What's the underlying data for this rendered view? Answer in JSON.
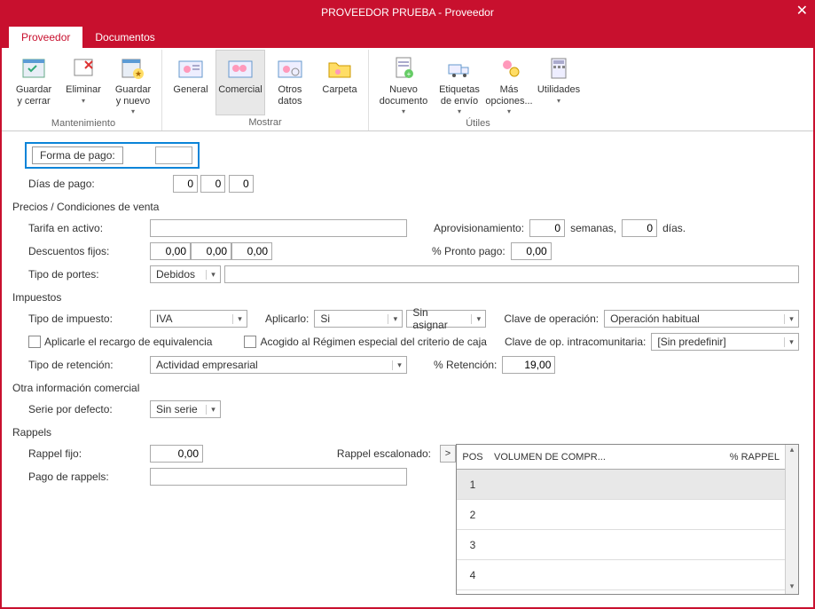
{
  "window": {
    "title": "PROVEEDOR PRUEBA - Proveedor",
    "close_tooltip": "Cerrar"
  },
  "tabs": {
    "active": "Proveedor",
    "items": [
      "Proveedor",
      "Documentos"
    ]
  },
  "ribbon": {
    "groups": [
      {
        "label": "Mantenimiento",
        "items": [
          {
            "label": "Guardar\ny cerrar",
            "icon": "save-close",
            "drop": false
          },
          {
            "label": "Eliminar",
            "icon": "delete",
            "drop": true
          },
          {
            "label": "Guardar\ny nuevo",
            "icon": "save-new",
            "drop": true
          }
        ]
      },
      {
        "label": "Mostrar",
        "items": [
          {
            "label": "General",
            "icon": "user-card",
            "drop": false
          },
          {
            "label": "Comercial",
            "icon": "users-card",
            "drop": false,
            "active": true
          },
          {
            "label": "Otros\ndatos",
            "icon": "user-gear",
            "drop": false
          },
          {
            "label": "Carpeta",
            "icon": "folder-user",
            "drop": false
          }
        ]
      },
      {
        "label": "Útiles",
        "items": [
          {
            "label": "Nuevo\ndocumento",
            "icon": "new-doc",
            "drop": true,
            "wide": true
          },
          {
            "label": "Etiquetas\nde envío",
            "icon": "truck",
            "drop": true
          },
          {
            "label": "Más\nopciones...",
            "icon": "more",
            "drop": true
          },
          {
            "label": "Utilidades",
            "icon": "calc",
            "drop": true
          }
        ]
      }
    ]
  },
  "form": {
    "forma_pago_label": "Forma de pago:",
    "forma_pago_value": "",
    "dias_pago_label": "Días de pago:",
    "dias_pago_values": [
      "0",
      "0",
      "0"
    ],
    "precios_title": "Precios / Condiciones de venta",
    "tarifa_label": "Tarifa en activo:",
    "tarifa_value": "",
    "aprov_label": "Aprovisionamiento:",
    "aprov_semanas": "0",
    "aprov_semanas_unit": "semanas,",
    "aprov_dias": "0",
    "aprov_dias_unit": "días.",
    "desc_label": "Descuentos fijos:",
    "desc_values": [
      "0,00",
      "0,00",
      "0,00"
    ],
    "pronto_label": "% Pronto pago:",
    "pronto_value": "0,00",
    "portes_label": "Tipo de portes:",
    "portes_value": "Debidos",
    "portes_extra": "",
    "impuestos_title": "Impuestos",
    "tipo_imp_label": "Tipo de impuesto:",
    "tipo_imp_value": "IVA",
    "aplicarlo_label": "Aplicarlo:",
    "aplicarlo_value": "Si",
    "asignar_value": "Sin asignar",
    "clave_op_label": "Clave de operación:",
    "clave_op_value": "Operación habitual",
    "recargo_label": "Aplicarle el recargo de equivalencia",
    "acogido_label": "Acogido al Régimen especial del criterio de caja",
    "clave_intra_label": "Clave de op. intracomunitaria:",
    "clave_intra_value": "[Sin predefinir]",
    "retencion_label": "Tipo de retención:",
    "retencion_value": "Actividad empresarial",
    "pct_retencion_label": "% Retención:",
    "pct_retencion_value": "19,00",
    "otra_info_title": "Otra información comercial",
    "serie_label": "Serie por defecto:",
    "serie_value": "Sin serie",
    "rappels_title": "Rappels",
    "rappel_fijo_label": "Rappel fijo:",
    "rappel_fijo_value": "0,00",
    "rappel_escalonado_label": "Rappel escalonado:",
    "pago_rappels_label": "Pago de rappels:",
    "pago_rappels_value": "",
    "rappel_table": {
      "headers": [
        "POS",
        "VOLUMEN DE COMPR...",
        "% RAPPEL"
      ],
      "rows": [
        {
          "pos": "1",
          "sel": true
        },
        {
          "pos": "2",
          "sel": false
        },
        {
          "pos": "3",
          "sel": false
        },
        {
          "pos": "4",
          "sel": false
        }
      ]
    }
  }
}
